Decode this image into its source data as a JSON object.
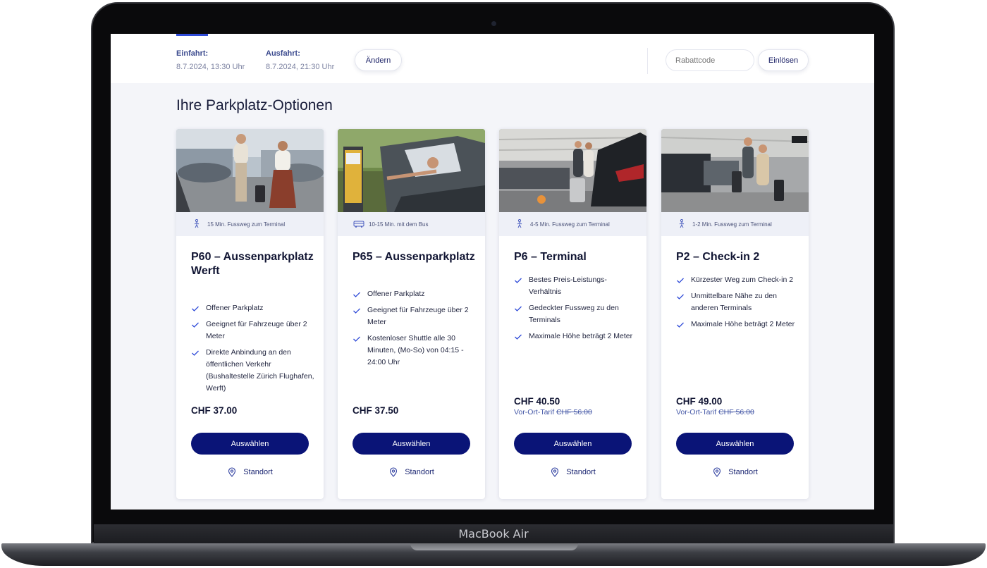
{
  "device": {
    "label": "MacBook Air"
  },
  "header": {
    "entry_label": "Einfahrt:",
    "entry_value": "8.7.2024, 13:30 Uhr",
    "exit_label": "Ausfahrt:",
    "exit_value": "8.7.2024, 21:30 Uhr",
    "change_label": "Ändern",
    "coupon_placeholder": "Rabattcode",
    "redeem_label": "Einlösen"
  },
  "section_title": "Ihre Parkplatz-Optionen",
  "cards": [
    {
      "meta_icon": "walking-person-icon",
      "meta": "15 Min. Fussweg zum Terminal",
      "title": "P60 – Aussenparkplatz Werft",
      "features": [
        "Offener Parkplatz",
        "Geeignet für Fahrzeuge über 2 Meter",
        "Direkte Anbindung an den öffentlichen Verkehr (Bushaltestelle Zürich Flughafen, Werft)"
      ],
      "price": "CHF 37.00",
      "onsite_label": "",
      "onsite_price": "",
      "select_label": "Auswählen",
      "location_label": "Standort"
    },
    {
      "meta_icon": "bus-icon",
      "meta": "10-15 Min. mit dem Bus",
      "title": "P65 – Aussenparkplatz",
      "features": [
        "Offener Parkplatz",
        "Geeignet für Fahrzeuge über 2 Meter",
        "Kostenloser Shuttle alle 30 Minuten, (Mo-So) von 04:15 - 24:00 Uhr"
      ],
      "price": "CHF 37.50",
      "onsite_label": "",
      "onsite_price": "",
      "select_label": "Auswählen",
      "location_label": "Standort"
    },
    {
      "meta_icon": "walking-person-icon",
      "meta": "4-5 Min. Fussweg zum Terminal",
      "title": "P6 – Terminal",
      "features": [
        "Bestes Preis-Leistungs-Verhältnis",
        "Gedeckter Fussweg zu den Terminals",
        "Maximale Höhe beträgt 2 Meter"
      ],
      "price": "CHF 40.50",
      "onsite_label": "Vor-Ort-Tarif",
      "onsite_price": "CHF 56.00",
      "select_label": "Auswählen",
      "location_label": "Standort"
    },
    {
      "meta_icon": "walking-person-icon",
      "meta": "1-2 Min. Fussweg zum Terminal",
      "title": "P2 – Check-in 2",
      "features": [
        "Kürzester Weg zum Check-in 2",
        "Unmittelbare Nähe zu den anderen Terminals",
        "Maximale Höhe beträgt 2 Meter"
      ],
      "price": "CHF 49.00",
      "onsite_label": "Vor-Ort-Tarif",
      "onsite_price": "CHF 56.00",
      "select_label": "Auswählen",
      "location_label": "Standort"
    }
  ],
  "colors": {
    "primary_button": "#0a1477",
    "accent": "#2f4bd8",
    "meta_bar": "#eef0f7"
  }
}
